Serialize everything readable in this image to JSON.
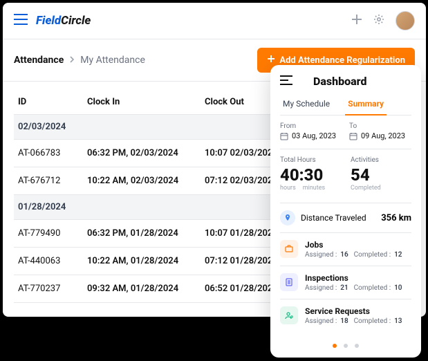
{
  "topbar": {
    "logo_field": "Field",
    "logo_circle": "Circle"
  },
  "breadcrumb": {
    "main": "Attendance",
    "sub": "My Attendance"
  },
  "add_button": "Add Attendance Regularization",
  "table": {
    "headers": {
      "id": "ID",
      "clock_in": "Clock In",
      "clock_out": "Clock Out"
    },
    "groups": [
      {
        "date": "02/03/2024",
        "rows": [
          {
            "id": "AT-066783",
            "in": "06:32 PM, 02/03/2024",
            "out": "10:07 02/03/2024"
          },
          {
            "id": "AT-676712",
            "in": "10:22 AM, 02/03/2024",
            "out": "07:12 02/03/2024"
          }
        ]
      },
      {
        "date": "01/28/2024",
        "rows": [
          {
            "id": "AT-779490",
            "in": "06:32 PM, 01/28/2024",
            "out": "10:07 01/28/2024"
          },
          {
            "id": "AT-440063",
            "in": "10:22 AM, 01/28/2024",
            "out": "07:12 01/28/2024"
          },
          {
            "id": "AT-770237",
            "in": "09:32 AM, 01/28/2024",
            "out": "06:52 01/28/2024"
          }
        ]
      }
    ]
  },
  "dashboard": {
    "title": "Dashboard",
    "tabs": {
      "schedule": "My Schedule",
      "summary": "Summary"
    },
    "from_label": "From",
    "from_value": "03 Aug, 2023",
    "to_label": "To",
    "to_value": "09 Aug, 2023",
    "total_hours_label": "Total Hours",
    "total_hours_value": "40:30",
    "hours_word": "hours",
    "minutes_word": "minutes",
    "activities_label": "Activities",
    "activities_value": "54",
    "completed_word": "Completed",
    "distance_label": "Distance Traveled",
    "distance_value": "356 km",
    "items": [
      {
        "title": "Jobs",
        "assigned_lbl": "Assigned :",
        "assigned": "16",
        "completed_lbl": "Completed :",
        "completed": "12",
        "bg": "#fff1e6",
        "color": "#ff7a00",
        "icon": "briefcase"
      },
      {
        "title": "Inspections",
        "assigned_lbl": "Assigned :",
        "assigned": "21",
        "completed_lbl": "Completed :",
        "completed": "10",
        "bg": "#eef0ff",
        "color": "#6366f1",
        "icon": "clipboard"
      },
      {
        "title": "Service Requests",
        "assigned_lbl": "Assigned :",
        "assigned": "18",
        "completed_lbl": "Completed :",
        "completed": "13",
        "bg": "#e6f7ef",
        "color": "#10b981",
        "icon": "user-cog"
      }
    ]
  }
}
